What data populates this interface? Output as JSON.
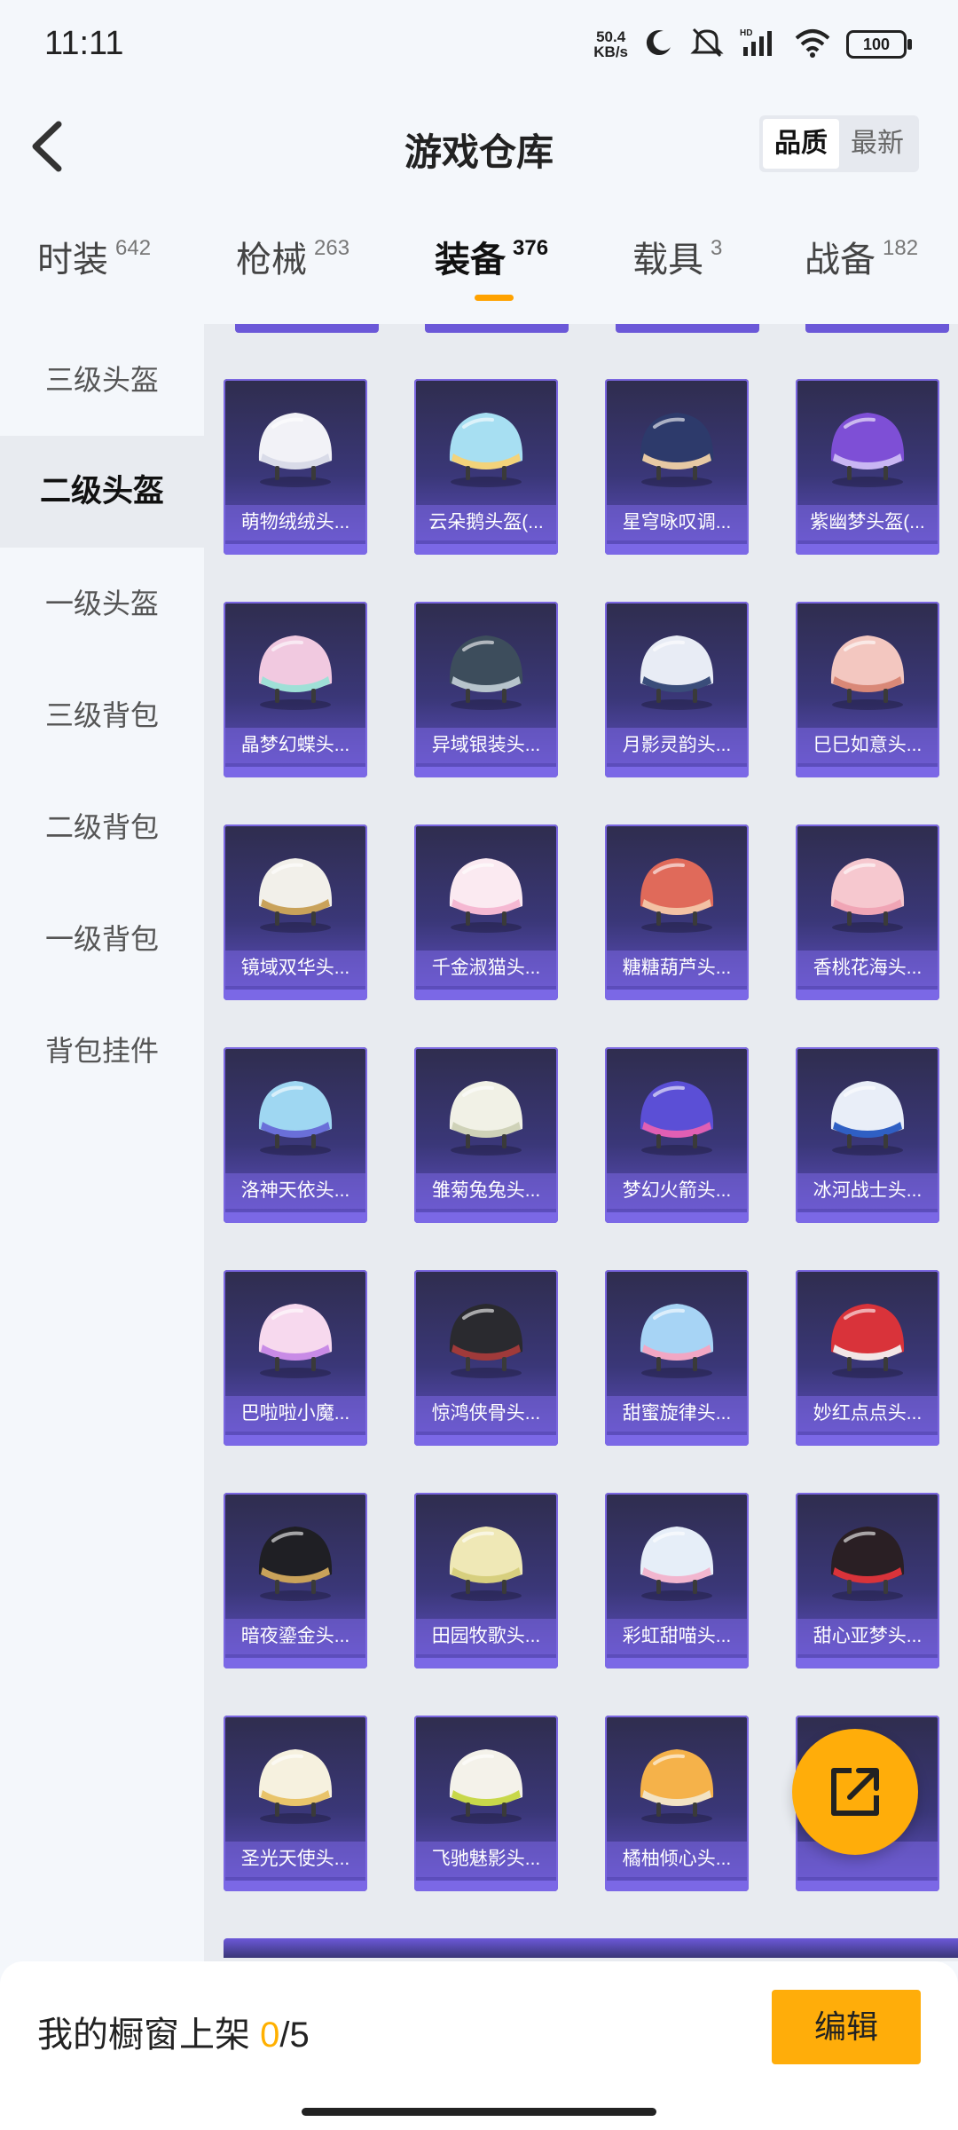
{
  "status_bar": {
    "time": "11:11",
    "network_speed_value": "50.4",
    "network_speed_unit": "KB/s",
    "battery": "100"
  },
  "header": {
    "title": "游戏仓库",
    "sort_options": [
      "品质",
      "最新"
    ],
    "sort_active": "品质"
  },
  "tabs": [
    {
      "label": "时装",
      "count": "642"
    },
    {
      "label": "枪械",
      "count": "263"
    },
    {
      "label": "装备",
      "count": "376"
    },
    {
      "label": "载具",
      "count": "3"
    },
    {
      "label": "战备",
      "count": "182"
    }
  ],
  "active_tab": "装备",
  "sidebar": {
    "items": [
      "三级头盔",
      "二级头盔",
      "一级头盔",
      "三级背包",
      "二级背包",
      "一级背包",
      "背包挂件"
    ],
    "active": "二级头盔"
  },
  "items": [
    {
      "name": "萌物绒绒头...",
      "colors": [
        "#f2f2f7",
        "#d9dbe8"
      ]
    },
    {
      "name": "云朵鹅头盔(...",
      "colors": [
        "#a7dff2",
        "#f3d37a"
      ]
    },
    {
      "name": "星穹咏叹调...",
      "colors": [
        "#2d3a6b",
        "#e7c9a4"
      ]
    },
    {
      "name": "紫幽梦头盔(...",
      "colors": [
        "#7e4fd6",
        "#c9b6f3"
      ]
    },
    {
      "name": "晶梦幻蝶头...",
      "colors": [
        "#f1c9e0",
        "#9fe0d7"
      ]
    },
    {
      "name": "异域银装头...",
      "colors": [
        "#3d4d5c",
        "#b7c4cc"
      ]
    },
    {
      "name": "月影灵韵头...",
      "colors": [
        "#e8ecf5",
        "#3a4d7a"
      ]
    },
    {
      "name": "巳巳如意头...",
      "colors": [
        "#f3c7c0",
        "#d98877"
      ]
    },
    {
      "name": "镜域双华头...",
      "colors": [
        "#f2f0ea",
        "#c9a25a"
      ]
    },
    {
      "name": "千金淑猫头...",
      "colors": [
        "#fbeaf1",
        "#f5b8d2"
      ]
    },
    {
      "name": "糖糖葫芦头...",
      "colors": [
        "#e06a5a",
        "#f3c2a4"
      ]
    },
    {
      "name": "香桃花海头...",
      "colors": [
        "#f6c8cf",
        "#f0a5b5"
      ]
    },
    {
      "name": "洛神天依头...",
      "colors": [
        "#9fd7f2",
        "#6a6fd9"
      ]
    },
    {
      "name": "雏菊兔兔头...",
      "colors": [
        "#f1f1e6",
        "#cfd2b8"
      ]
    },
    {
      "name": "梦幻火箭头...",
      "colors": [
        "#5b4fd6",
        "#e05fb4"
      ]
    },
    {
      "name": "冰河战士头...",
      "colors": [
        "#e9eef8",
        "#2f5fc4"
      ]
    },
    {
      "name": "巴啦啦小魔...",
      "colors": [
        "#f7d9ee",
        "#c88be6"
      ]
    },
    {
      "name": "惊鸿侠骨头...",
      "colors": [
        "#2a2a2f",
        "#a03a3a"
      ]
    },
    {
      "name": "甜蜜旋律头...",
      "colors": [
        "#a7d4f5",
        "#f2a7c4"
      ]
    },
    {
      "name": "妙红点点头...",
      "colors": [
        "#d9333a",
        "#f2e6e6"
      ]
    },
    {
      "name": "暗夜鎏金头...",
      "colors": [
        "#1f1f24",
        "#c9a25a"
      ]
    },
    {
      "name": "田园牧歌头...",
      "colors": [
        "#efe8b6",
        "#d7cf7e"
      ]
    },
    {
      "name": "彩虹甜喵头...",
      "colors": [
        "#e6eef8",
        "#f2b6cf"
      ]
    },
    {
      "name": "甜心亚梦头...",
      "colors": [
        "#2a1f24",
        "#d9333a"
      ]
    },
    {
      "name": "圣光天使头...",
      "colors": [
        "#f6f1df",
        "#e9c46a"
      ]
    },
    {
      "name": "飞驰魅影头...",
      "colors": [
        "#f4f2ea",
        "#c8d84a"
      ]
    },
    {
      "name": "橘柚倾心头...",
      "colors": [
        "#f5b24a",
        "#f2e3c4"
      ]
    },
    {
      "name": "",
      "colors": [
        "#9be3f2",
        "#e8eef8"
      ]
    }
  ],
  "fab": {
    "icon": "share-icon"
  },
  "bottom_bar": {
    "label": "我的橱窗上架",
    "used": "0",
    "total": "/5",
    "edit_label": "编辑"
  },
  "accent_color": "#ffad0a"
}
